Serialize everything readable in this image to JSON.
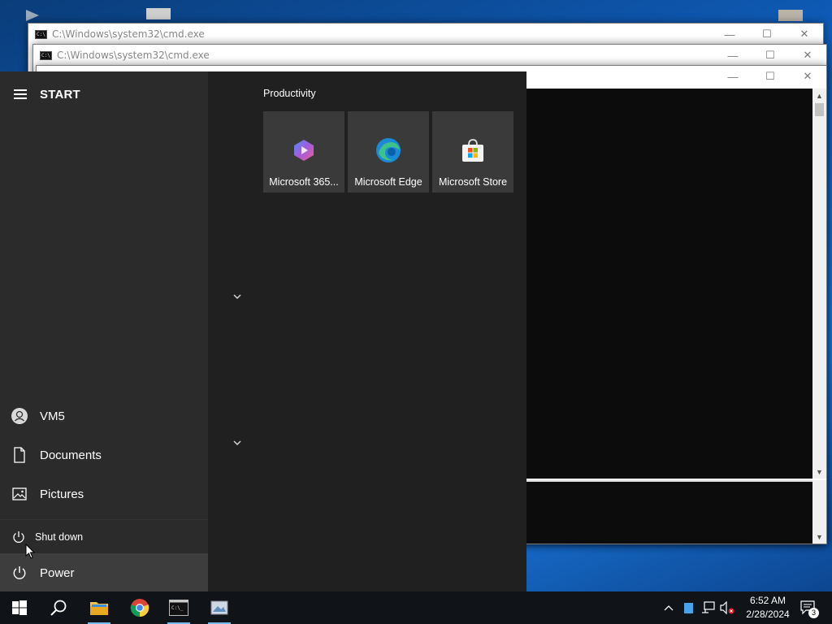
{
  "desktop": {
    "icons": [
      "desktop-icon-1",
      "desktop-icon-2",
      "desktop-icon-3"
    ]
  },
  "windows": [
    {
      "title": "C:\\Windows\\system32\\cmd.exe",
      "minimize": "—",
      "maximize": "☐",
      "close": "✕"
    },
    {
      "title": "C:\\Windows\\system32\\cmd.exe",
      "minimize": "—",
      "maximize": "☐",
      "close": "✕"
    },
    {
      "title": "",
      "minimize": "—",
      "maximize": "☐",
      "close": "✕"
    }
  ],
  "start_menu": {
    "header": {
      "menu_icon": "hamburger-icon",
      "title": "START"
    },
    "left_items": [
      {
        "label": "VM5",
        "icon": "user-avatar-icon"
      },
      {
        "label": "Documents",
        "icon": "document-icon"
      },
      {
        "label": "Pictures",
        "icon": "pictures-icon"
      }
    ],
    "shutdown_option": {
      "label": "Shut down",
      "icon": "power-icon"
    },
    "power": {
      "label": "Power",
      "icon": "power-icon"
    },
    "group": {
      "title": "Productivity",
      "tiles": [
        {
          "label": "Microsoft 365...",
          "icon": "microsoft-365-icon"
        },
        {
          "label": "Microsoft Edge",
          "icon": "edge-icon"
        },
        {
          "label": "Microsoft Store",
          "icon": "store-icon"
        }
      ]
    },
    "expanders": [
      "chevron-down-icon",
      "chevron-down-icon"
    ]
  },
  "taskbar": {
    "buttons": [
      {
        "name": "start",
        "icon": "windows-logo-icon"
      },
      {
        "name": "search",
        "icon": "search-icon"
      },
      {
        "name": "file-explorer",
        "icon": "folder-icon"
      },
      {
        "name": "chrome",
        "icon": "chrome-icon"
      },
      {
        "name": "cmd",
        "icon": "terminal-icon"
      },
      {
        "name": "app",
        "icon": "paint-icon"
      }
    ],
    "tray": {
      "chevron": "^",
      "time": "6:52 AM",
      "date": "2/28/2024",
      "notification_count": "3"
    }
  },
  "colors": {
    "start_bg": "#202020",
    "start_left_bg": "#2b2b2b",
    "tile_bg": "#3a3a3a",
    "taskbar_bg": "#101418",
    "accent": "#76b9ed"
  }
}
